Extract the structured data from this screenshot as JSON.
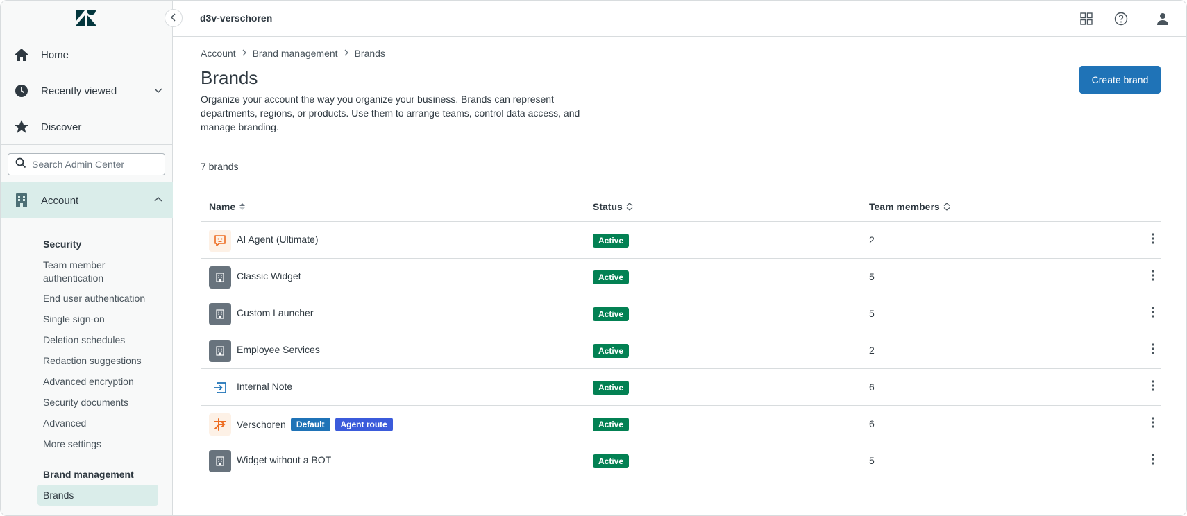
{
  "topbar": {
    "workspace": "d3v-verschoren",
    "icons": [
      "apps-icon",
      "help-icon",
      "user-icon"
    ]
  },
  "sidebar": {
    "logo": "zendesk-logo",
    "nav": [
      {
        "label": "Home",
        "icon": "home-icon"
      },
      {
        "label": "Recently viewed",
        "icon": "clock-icon"
      },
      {
        "label": "Discover",
        "icon": "star-icon"
      }
    ],
    "search_placeholder": "Search Admin Center",
    "account_label": "Account",
    "security": {
      "title": "Security",
      "links": [
        "Team member authentication",
        "End user authentication",
        "Single sign-on",
        "Deletion schedules",
        "Redaction suggestions",
        "Advanced encryption",
        "Security documents",
        "Advanced",
        "More settings"
      ]
    },
    "brand_management": {
      "title": "Brand management",
      "active_link": "Brands"
    }
  },
  "breadcrumb": [
    "Account",
    "Brand management",
    "Brands"
  ],
  "page": {
    "title": "Brands",
    "description": "Organize your account the way you organize your business. Brands can represent departments, regions, or products. Use them to arrange teams, control data access, and manage branding.",
    "create_button": "Create brand",
    "count": "7 brands"
  },
  "table": {
    "columns": [
      "Name",
      "Status",
      "Team members"
    ],
    "rows": [
      {
        "name": "AI Agent (Ultimate)",
        "icon": "chat-bot-icon",
        "status": "Active",
        "members": "2",
        "tags": []
      },
      {
        "name": "Classic Widget",
        "icon": "building-icon",
        "status": "Active",
        "members": "5",
        "tags": []
      },
      {
        "name": "Custom Launcher",
        "icon": "building-icon",
        "status": "Active",
        "members": "5",
        "tags": []
      },
      {
        "name": "Employee Services",
        "icon": "building-icon",
        "status": "Active",
        "members": "2",
        "tags": []
      },
      {
        "name": "Internal Note",
        "icon": "login-arrow-icon",
        "status": "Active",
        "members": "6",
        "tags": []
      },
      {
        "name": "Verschoren",
        "icon": "brand-logo-icon",
        "status": "Active",
        "members": "6",
        "tags": [
          "Default",
          "Agent route"
        ]
      },
      {
        "name": "Widget without a BOT",
        "icon": "building-icon",
        "status": "Active",
        "members": "5",
        "tags": []
      }
    ]
  },
  "colors": {
    "primary": "#1f73b7",
    "active": "#038153",
    "agent_route": "#3b5bdb",
    "nav_active": "#daedea"
  }
}
